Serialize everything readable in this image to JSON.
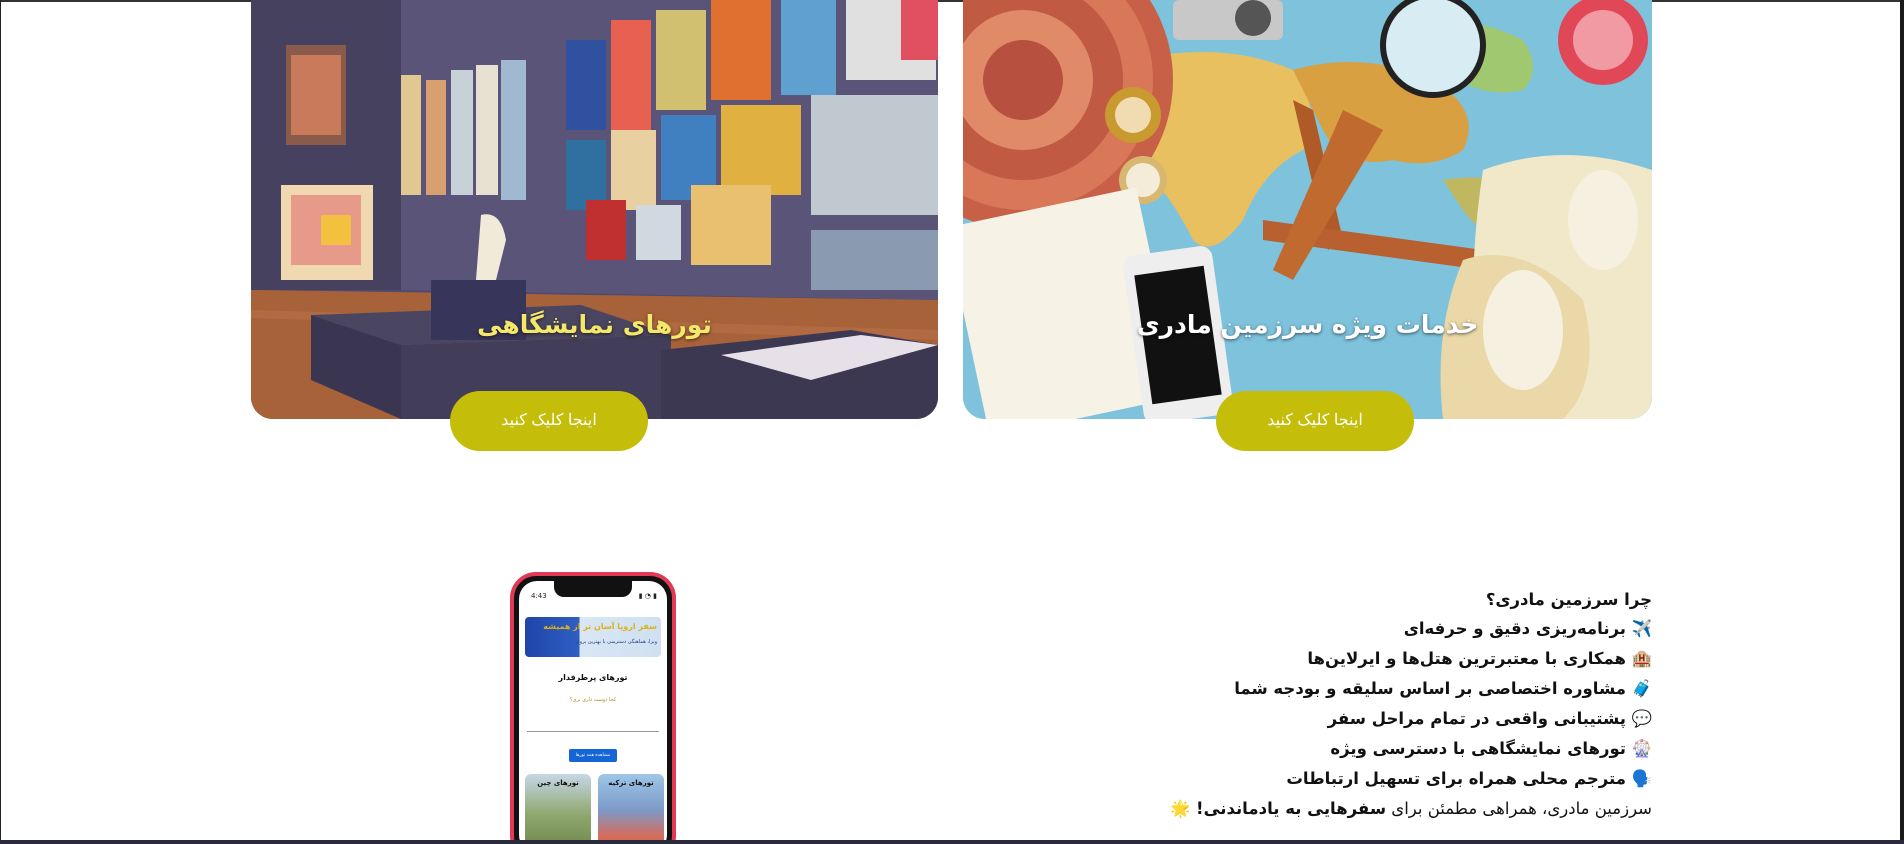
{
  "cards": [
    {
      "title": "تورهای نمایشگاهی",
      "button_label": "اینجا کلیک کنید"
    },
    {
      "title": "خدمات ویژه سرزمین مادری",
      "button_label": "اینجا کلیک کنید"
    }
  ],
  "phone": {
    "time": "4:43",
    "status": "▮ ◔ ▮",
    "banner_title": "سفر اروپا آسان تر از همیشه",
    "banner_subtitle": "ویزا، هماهنگی دسترسی با بهترین پرواز",
    "heading": "تورهای پرطرفدار",
    "subheading": "کجا دوست داری بری؟",
    "button_label": "مشاهده همه تورها",
    "tiles": [
      "تورهای ترکیه",
      "تورهای چین"
    ]
  },
  "why": {
    "title": "چرا سرزمین مادری؟",
    "items": [
      {
        "emoji": "✈️",
        "text": "برنامه‌ریزی دقیق و حرفه‌ای"
      },
      {
        "emoji": "🏨",
        "text": "همکاری با معتبرترین هتل‌ها و ایرلاین‌ها"
      },
      {
        "emoji": "🧳",
        "text": "مشاوره اختصاصی بر اساس سلیقه و بودجه شما"
      },
      {
        "emoji": "💬",
        "text": "پشتیبانی واقعی در تمام مراحل سفر"
      },
      {
        "emoji": "🎡",
        "text": "تورهای نمایشگاهی با دسترسی ویژه"
      },
      {
        "emoji": "🗣️",
        "text": "مترجم محلی همراه برای تسهیل ارتباطات"
      }
    ],
    "footer_prefix": "سرزمین مادری، همراهی مطمئن برای ",
    "footer_bold": "سفرهایی به یادماندنی!",
    "footer_emoji": "🌟"
  }
}
